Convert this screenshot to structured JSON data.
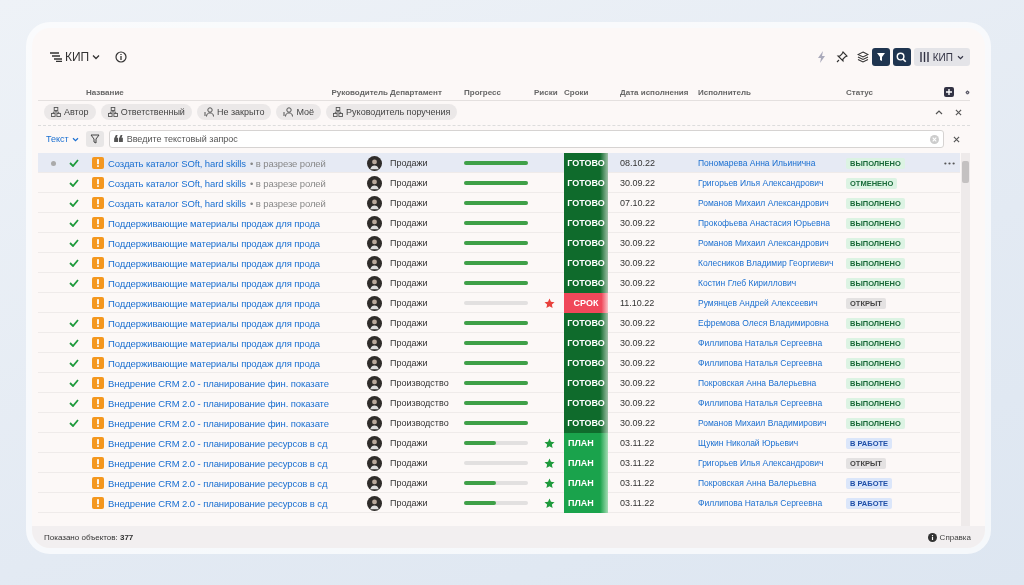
{
  "app": {
    "title": "КИП"
  },
  "toolbar": {
    "filter_on": true,
    "search_on": true,
    "view": "КИП"
  },
  "columns": [
    "Название",
    "Руководитель",
    "Департамент",
    "Прогресс",
    "Риски",
    "Сроки",
    "Дата исполнения",
    "Исполнитель",
    "Статус"
  ],
  "chips": [
    {
      "label": "Автор",
      "kind": "hierarchy"
    },
    {
      "label": "Ответственный",
      "kind": "hierarchy"
    },
    {
      "label": "Не закрыто",
      "kind": "person"
    },
    {
      "label": "Моё",
      "kind": "person"
    },
    {
      "label": "Руководитель поручения",
      "kind": "hierarchy"
    }
  ],
  "search": {
    "mode": "Текст",
    "placeholder": "Введите текстовый запрос"
  },
  "rows": [
    {
      "selected": true,
      "done": true,
      "title": "Создать каталог SOft, hard skills",
      "subtitle": "• в разрезе ролей",
      "department": "Продажи",
      "level": 1,
      "deadline": {
        "label": "ГОТОВО",
        "kind": "done"
      },
      "date": "08.10.22",
      "assignee": "Пономарева Анна Ильинична",
      "status": {
        "label": "ВЫПОЛНЕНО",
        "kind": "done"
      }
    },
    {
      "selected": false,
      "done": true,
      "title": "Создать каталог SOft, hard skills",
      "subtitle": "• в разрезе ролей",
      "department": "Продажи",
      "level": 1,
      "deadline": {
        "label": "ГОТОВО",
        "kind": "done"
      },
      "date": "30.09.22",
      "assignee": "Григорьев Илья Александрович",
      "status": {
        "label": "ОТМЕНЕНО",
        "kind": "cancelled"
      }
    },
    {
      "selected": false,
      "done": true,
      "title": "Создать каталог SOft, hard skills",
      "subtitle": "• в разрезе ролей",
      "department": "Продажи",
      "level": 1,
      "deadline": {
        "label": "ГОТОВО",
        "kind": "done"
      },
      "date": "07.10.22",
      "assignee": "Романов Михаил Александрович",
      "status": {
        "label": "ВЫПОЛНЕНО",
        "kind": "done"
      }
    },
    {
      "selected": false,
      "done": true,
      "title": "Поддерживающие материалы продаж для прода",
      "department": "Продажи",
      "level": 1,
      "deadline": {
        "label": "ГОТОВО",
        "kind": "done"
      },
      "date": "30.09.22",
      "assignee": "Прокофьева Анастасия Юрьевна",
      "status": {
        "label": "ВЫПОЛНЕНО",
        "kind": "done"
      }
    },
    {
      "selected": false,
      "done": true,
      "title": "Поддерживающие материалы продаж для прода",
      "department": "Продажи",
      "level": 1,
      "deadline": {
        "label": "ГОТОВО",
        "kind": "done"
      },
      "date": "30.09.22",
      "assignee": "Романов Михаил Александрович",
      "status": {
        "label": "ВЫПОЛНЕНО",
        "kind": "done"
      }
    },
    {
      "selected": false,
      "done": true,
      "title": "Поддерживающие материалы продаж для прода",
      "department": "Продажи",
      "level": 1,
      "deadline": {
        "label": "ГОТОВО",
        "kind": "done"
      },
      "date": "30.09.22",
      "assignee": "Колесников Владимир Георгиевич",
      "status": {
        "label": "ВЫПОЛНЕНО",
        "kind": "done"
      }
    },
    {
      "selected": false,
      "done": true,
      "title": "Поддерживающие материалы продаж для прода",
      "department": "Продажи",
      "level": 1,
      "deadline": {
        "label": "ГОТОВО",
        "kind": "done"
      },
      "date": "30.09.22",
      "assignee": "Костин Глеб Кириллович",
      "status": {
        "label": "ВЫПОЛНЕНО",
        "kind": "done"
      }
    },
    {
      "selected": false,
      "done": false,
      "title": "Поддерживающие материалы продаж для прода",
      "department": "Продажи",
      "level": 0,
      "risk": {
        "color": "#e8413c"
      },
      "deadline": {
        "label": "СРОК",
        "kind": "overdue"
      },
      "date": "11.10.22",
      "assignee": "Румянцев Андрей Алексеевич",
      "status": {
        "label": "ОТКРЫТ",
        "kind": "open"
      }
    },
    {
      "selected": false,
      "done": true,
      "title": "Поддерживающие материалы продаж для прода",
      "department": "Продажи",
      "level": 1,
      "deadline": {
        "label": "ГОТОВО",
        "kind": "done"
      },
      "date": "30.09.22",
      "assignee": "Ефремова Олеся Владимировна",
      "status": {
        "label": "ВЫПОЛНЕНО",
        "kind": "done"
      }
    },
    {
      "selected": false,
      "done": true,
      "title": "Поддерживающие материалы продаж для прода",
      "department": "Продажи",
      "level": 1,
      "deadline": {
        "label": "ГОТОВО",
        "kind": "done"
      },
      "date": "30.09.22",
      "assignee": "Филлипова Наталья Сергеевна",
      "status": {
        "label": "ВЫПОЛНЕНО",
        "kind": "done"
      }
    },
    {
      "selected": false,
      "done": true,
      "title": "Поддерживающие материалы продаж для прода",
      "department": "Продажи",
      "level": 1,
      "deadline": {
        "label": "ГОТОВО",
        "kind": "done"
      },
      "date": "30.09.22",
      "assignee": "Филлипова Наталья Сергеевна",
      "status": {
        "label": "ВЫПОЛНЕНО",
        "kind": "done"
      }
    },
    {
      "selected": false,
      "done": true,
      "title": "Внедрение CRM 2.0 - планирование фин. показате",
      "department": "Производство",
      "level": 1,
      "deadline": {
        "label": "ГОТОВО",
        "kind": "done"
      },
      "date": "30.09.22",
      "assignee": "Покровская Анна Валерьевна",
      "status": {
        "label": "ВЫПОЛНЕНО",
        "kind": "done"
      }
    },
    {
      "selected": false,
      "done": true,
      "title": "Внедрение CRM 2.0 - планирование фин. показате",
      "department": "Производство",
      "level": 1,
      "deadline": {
        "label": "ГОТОВО",
        "kind": "done"
      },
      "date": "30.09.22",
      "assignee": "Филлипова Наталья Сергеевна",
      "status": {
        "label": "ВЫПОЛНЕНО",
        "kind": "done"
      }
    },
    {
      "selected": false,
      "done": true,
      "title": "Внедрение CRM 2.0 - планирование фин. показате",
      "department": "Производство",
      "level": 1,
      "deadline": {
        "label": "ГОТОВО",
        "kind": "done"
      },
      "date": "30.09.22",
      "assignee": "Романов Михаил Владимирович",
      "status": {
        "label": "ВЫПОЛНЕНО",
        "kind": "done"
      }
    },
    {
      "selected": false,
      "done": false,
      "title": "Внедрение CRM 2.0 - планирование ресурсов в сд",
      "department": "Продажи",
      "level": 0.5,
      "risk": {
        "color": "#1e9a3c"
      },
      "deadline": {
        "label": "ПЛАН",
        "kind": "plan"
      },
      "date": "03.11.22",
      "assignee": "Щукин Николай Юрьевич",
      "status": {
        "label": "В РАБОТЕ",
        "kind": "in_work"
      }
    },
    {
      "selected": false,
      "done": false,
      "title": "Внедрение CRM 2.0 - планирование ресурсов в сд",
      "department": "Продажи",
      "level": 0,
      "risk": {
        "color": "#1e9a3c"
      },
      "deadline": {
        "label": "ПЛАН",
        "kind": "plan"
      },
      "date": "03.11.22",
      "assignee": "Григорьев Илья Александрович",
      "status": {
        "label": "ОТКРЫТ",
        "kind": "open"
      }
    },
    {
      "selected": false,
      "done": false,
      "title": "Внедрение CRM 2.0 - планирование ресурсов в сд",
      "department": "Продажи",
      "level": 0.5,
      "risk": {
        "color": "#1e9a3c"
      },
      "deadline": {
        "label": "ПЛАН",
        "kind": "plan"
      },
      "date": "03.11.22",
      "assignee": "Покровская Анна Валерьевна",
      "status": {
        "label": "В РАБОТЕ",
        "kind": "in_work"
      }
    },
    {
      "selected": false,
      "done": false,
      "title": "Внедрение CRM 2.0 - планирование ресурсов в сд",
      "department": "Продажи",
      "level": 0.5,
      "risk": {
        "color": "#1e9a3c"
      },
      "deadline": {
        "label": "ПЛАН",
        "kind": "plan"
      },
      "date": "03.11.22",
      "assignee": "Филлипова Наталья Сергеевна",
      "status": {
        "label": "В РАБОТЕ",
        "kind": "in_work"
      }
    }
  ],
  "footer": {
    "count": "Показано объектов: **377**",
    "help": "Справка"
  }
}
